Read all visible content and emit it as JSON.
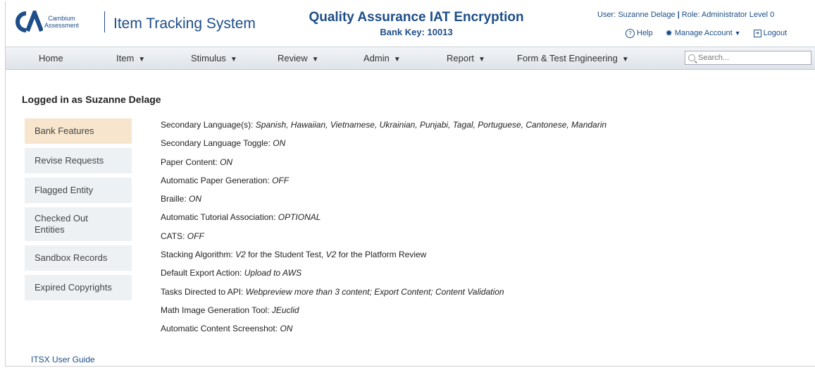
{
  "header": {
    "logo_text_line1": "Cambium",
    "logo_text_line2": "Assessment",
    "app_title": "Item Tracking System",
    "page_title": "Quality Assurance IAT Encryption",
    "bank_key": "Bank Key: 10013",
    "user": "User: Suzanne Delage",
    "role": "Role: Administrator Level 0",
    "help_label": "Help",
    "manage_account_label": "Manage Account",
    "logout_label": "Logout",
    "brand_color": "#1d4e89"
  },
  "nav": {
    "items": [
      {
        "label": "Home",
        "caret": ""
      },
      {
        "label": "Item",
        "caret": "▼"
      },
      {
        "label": "Stimulus",
        "caret": "▼"
      },
      {
        "label": "Review",
        "caret": "▼"
      },
      {
        "label": "Admin",
        "caret": "▼"
      },
      {
        "label": "Report",
        "caret": "▼"
      },
      {
        "label": "Form & Test Engineering",
        "caret": "▼"
      }
    ],
    "search_placeholder": "Search..."
  },
  "main": {
    "logged_in": "Logged in as Suzanne Delage",
    "sidebar": [
      "Bank Features",
      "Revise Requests",
      "Flagged Entity",
      "Checked Out Entities",
      "Sandbox Records",
      "Expired Copyrights"
    ],
    "active_sidebar": "Bank Features",
    "features": [
      {
        "label": "Secondary Language(s): ",
        "value": "Spanish, Hawaiian, Vietnamese, Ukrainian, Punjabi, Tagal, Portuguese, Cantonese, Mandarin"
      },
      {
        "label": "Secondary Language Toggle: ",
        "value": "ON"
      },
      {
        "label": "Paper Content: ",
        "value": "ON"
      },
      {
        "label": "Automatic Paper Generation: ",
        "value": "OFF"
      },
      {
        "label": "Braille: ",
        "value": "ON"
      },
      {
        "label": "Automatic Tutorial Association: ",
        "value": "OPTIONAL"
      },
      {
        "label": "CATS: ",
        "value": "OFF"
      },
      {
        "label": "Stacking Algorithm: ",
        "value": "V2",
        "label2": " for the Student Test, ",
        "value2": "V2",
        "label3": " for the Platform Review"
      },
      {
        "label": "Default Export Action: ",
        "value": "Upload to AWS"
      },
      {
        "label": "Tasks Directed to API: ",
        "value": "Webpreview more than 3 content; Export Content; Content Validation"
      },
      {
        "label": "Math Image Generation Tool: ",
        "value": "JEuclid"
      },
      {
        "label": "Automatic Content Screenshot: ",
        "value": "ON"
      }
    ],
    "guide_link": "ITSX User Guide"
  }
}
